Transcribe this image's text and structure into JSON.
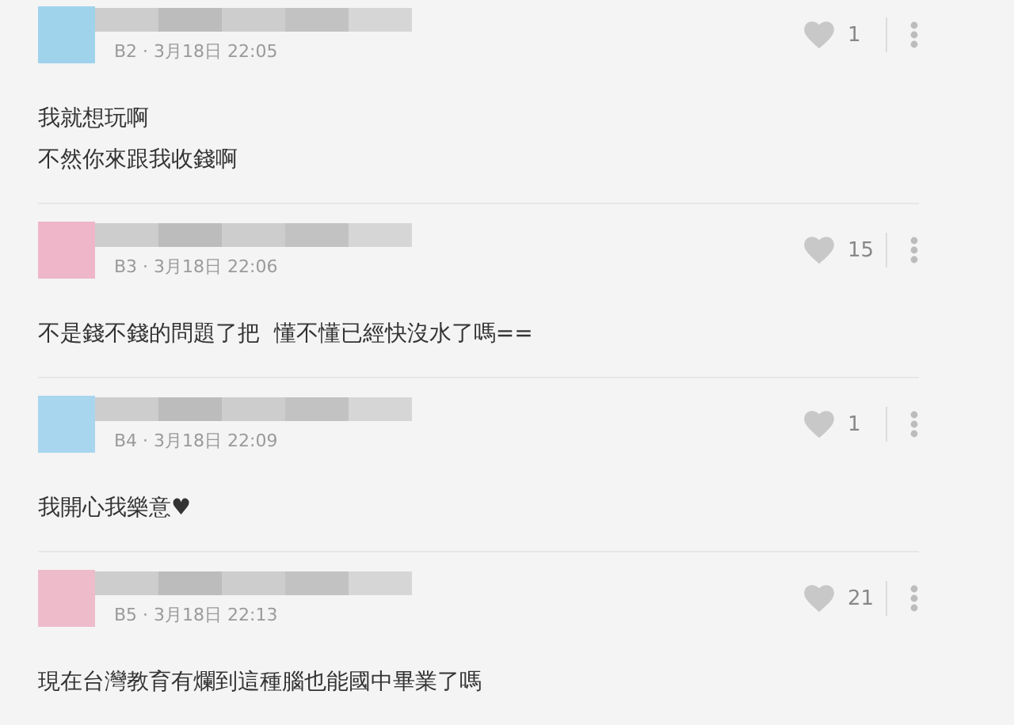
{
  "comments": [
    {
      "color": "#9fd3ec",
      "meta": "B2 · 3月18日 22:05",
      "likes": "1",
      "lines": [
        "我就想玩啊",
        "不然你來跟我收錢啊"
      ]
    },
    {
      "color": "#eeb6c8",
      "meta": "B3 · 3月18日 22:06",
      "likes": "15",
      "lines": [
        "不是錢不錢的問題了把  懂不懂已經快沒水了嗎=="
      ]
    },
    {
      "color": "#a8d6ee",
      "meta": "B4 · 3月18日 22:09",
      "likes": "1",
      "lines": [
        "我開心我樂意♥"
      ]
    },
    {
      "color": "#eebbcb",
      "meta": "B5 · 3月18日 22:13",
      "likes": "21",
      "lines": [
        "現在台灣教育有爛到這種腦也能國中畢業了嗎"
      ]
    }
  ]
}
